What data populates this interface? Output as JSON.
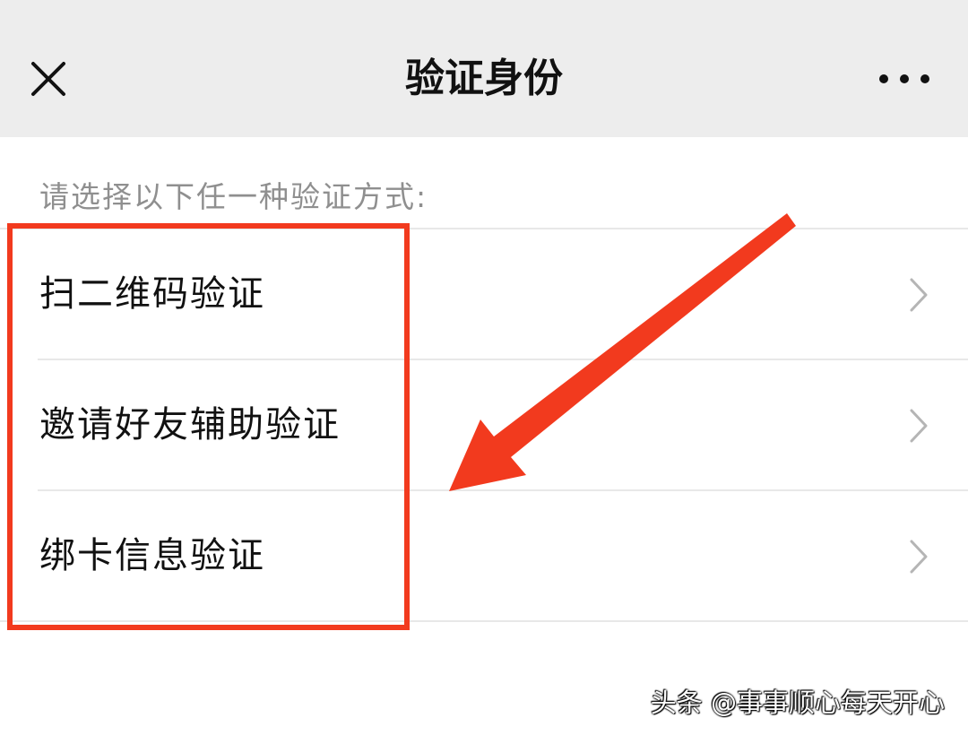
{
  "navbar": {
    "title": "验证身份",
    "close_icon": "close-icon",
    "more_icon": "more-dots-icon"
  },
  "content": {
    "prompt": "请选择以下任一种验证方式:",
    "options": [
      {
        "label": "扫二维码验证",
        "icon": "chevron-right-icon"
      },
      {
        "label": "邀请好友辅助验证",
        "icon": "chevron-right-icon"
      },
      {
        "label": "绑卡信息验证",
        "icon": "chevron-right-icon"
      }
    ]
  },
  "annotation": {
    "highlight_color": "#f23a1e",
    "arrow_icon": "arrow-down-left-icon"
  },
  "watermark": {
    "text": "头条 @事事顺心每天开心"
  },
  "colors": {
    "navbar_bg": "#ededed",
    "text_primary": "#111111",
    "text_secondary": "#8f8f8f",
    "divider": "#e8e8e8",
    "chevron": "#b5b5b5"
  }
}
